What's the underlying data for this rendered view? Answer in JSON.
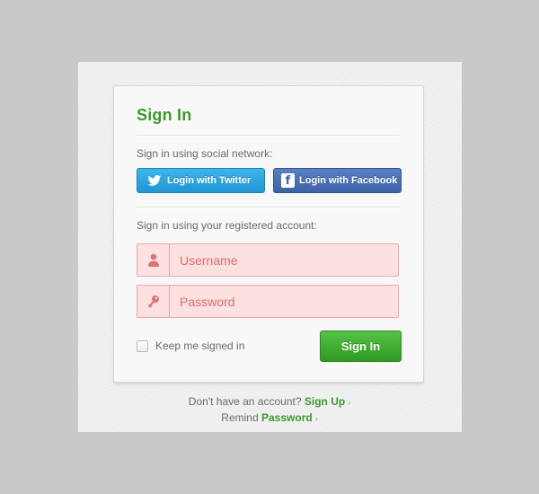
{
  "signin": {
    "title": "Sign In",
    "social_label": "Sign in using social network:",
    "twitter_button": "Login with Twitter",
    "facebook_button": "Login with Facebook",
    "account_label": "Sign in using your registered account:",
    "username_placeholder": "Username",
    "password_placeholder": "Password",
    "keep_signed_in": "Keep me signed in",
    "submit_button": "Sign In"
  },
  "footer": {
    "no_account_text": "Don't have an account?",
    "signup_link": "Sign Up",
    "remind_text": "Remind",
    "password_link": "Password",
    "chevron": "›"
  },
  "icons": {
    "twitter": "twitter-bird-icon",
    "facebook": "facebook-f-icon",
    "user": "user-icon",
    "key": "key-icon"
  },
  "colors": {
    "brand_green": "#3b9a2c",
    "twitter_blue": "#1f95d3",
    "facebook_blue": "#3d61a6",
    "field_error_bg": "#fde0e0",
    "field_error_border": "#f0a6a6"
  }
}
